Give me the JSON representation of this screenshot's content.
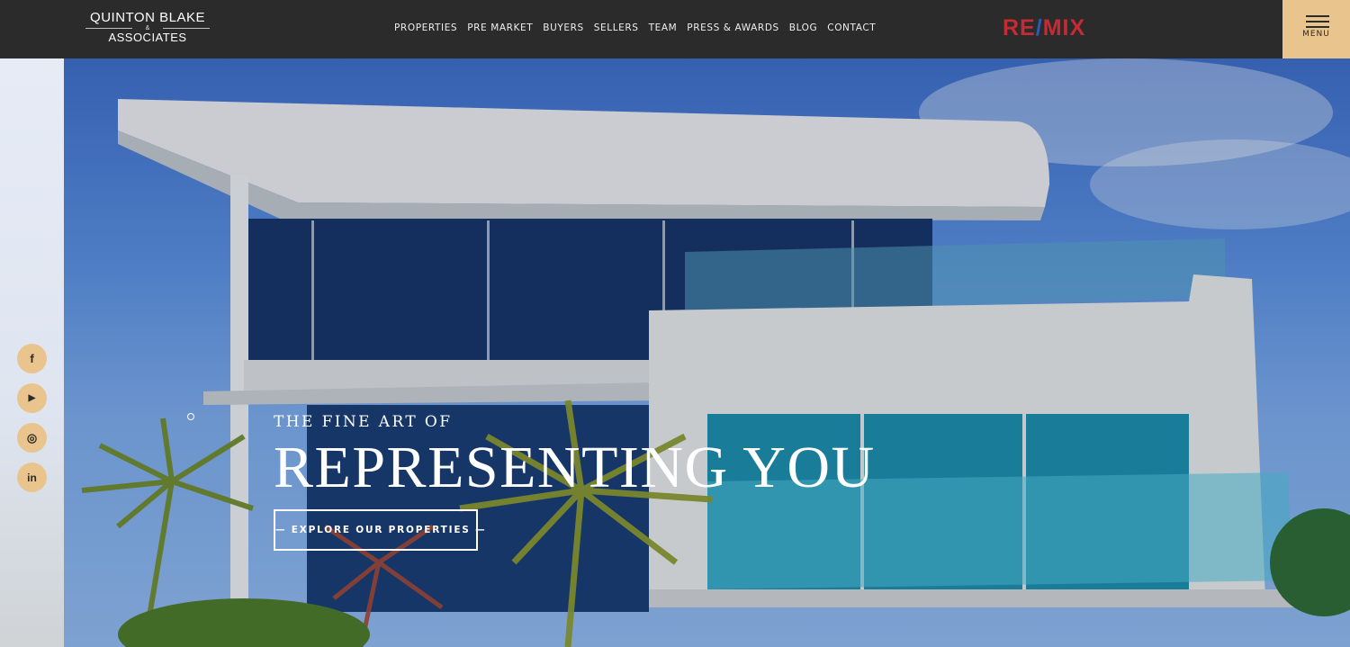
{
  "header": {
    "logo": {
      "line1": "QUINTON BLAKE",
      "line2": "&",
      "line3": "ASSOCIATES"
    },
    "nav": [
      {
        "label": "PROPERTIES"
      },
      {
        "label": "PRE MARKET"
      },
      {
        "label": "BUYERS"
      },
      {
        "label": "SELLERS"
      },
      {
        "label": "TEAM"
      },
      {
        "label": "PRESS & AWARDS"
      },
      {
        "label": "BLOG"
      },
      {
        "label": "CONTACT"
      }
    ],
    "partner_logo": {
      "left": "RE",
      "slash": "/",
      "right": "MIX"
    },
    "menu": {
      "label": "MENU"
    }
  },
  "hero": {
    "kicker": "THE FINE ART OF",
    "headline": "REPRESENTING YOU",
    "cta_label": "— EXPLORE OUR PROPERTIES —"
  },
  "social": [
    {
      "icon": "facebook-icon",
      "glyph": "f"
    },
    {
      "icon": "youtube-icon",
      "glyph": "▶"
    },
    {
      "icon": "instagram-icon",
      "glyph": "◎"
    },
    {
      "icon": "linkedin-icon",
      "glyph": "in"
    }
  ],
  "colors": {
    "header_bg": "#2b2b2b",
    "accent_gold": "#e9c48d",
    "remax_red": "#c62a33",
    "remax_blue": "#2a5bb8"
  }
}
